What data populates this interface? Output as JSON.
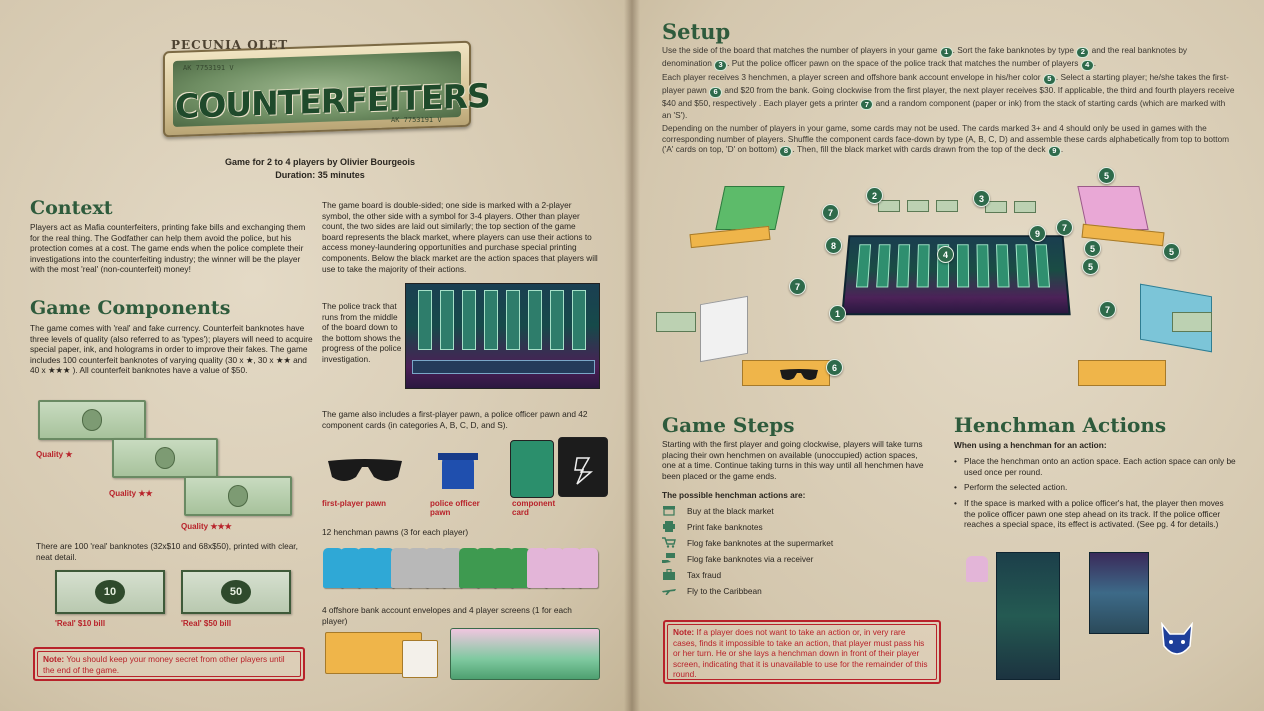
{
  "logo": {
    "brand": "PECUNIA OLET",
    "title": "COUNTERFEITERS",
    "serial_top": "AK 7753191 V",
    "serial_bottom": "AK 7753191 V"
  },
  "credits": {
    "line1": "Game for 2 to 4 players by Olivier Bourgeois",
    "line2": "Duration: 35 minutes"
  },
  "context": {
    "title": "Context",
    "text": "Players act as Mafia counterfeiters, printing fake bills and exchanging them for the real thing. The Godfather can help them avoid the police, but his protection comes at a cost. The game ends when the police complete their investigations into the counterfeiting industry; the winner will be the player with the most 'real' (non-counterfeit) money!"
  },
  "components": {
    "title": "Game Components",
    "text1": "The game comes with 'real' and fake currency. Counterfeit banknotes have three levels of quality (also referred to as 'types'); players will need to acquire special paper, ink, and holograms in order to improve their fakes. The game includes 100 counterfeit banknotes of varying quality (30 x ★, 30 x ★★ and 40 x ★★★ ). All counterfeit banknotes have a value of $50.",
    "quality1": "Quality ★",
    "quality2": "Quality ★★",
    "quality3": "Quality ★★★",
    "real_text": "There are 100 'real' banknotes (32x$10 and 68x$50), printed with clear, neat detail.",
    "real10_value": "10",
    "real50_value": "50",
    "real10_label": "'Real' $10 bill",
    "real50_label": "'Real' $50 bill",
    "note_label": "Note:",
    "note_text": "You should keep your money secret from other players until the end of the game."
  },
  "board": {
    "text": "The game board is double-sided; one side is marked with a 2-player symbol, the other side with a symbol for 3-4 players. Other than player count, the two sides are laid out similarly; the top section of the game board represents the black market, where players can use their actions to access money-laundering opportunities and purchase special printing components. Below the black market are the action spaces that players will use to take the majority of their actions.",
    "police_text": "The police track that runs from the middle of the board down to the bottom shows the progress of the police investigation.",
    "also_text": "The game also includes a first-player pawn, a police officer pawn and 42 component cards (in categories A, B, C, D, and S).",
    "first_player": "first-player pawn",
    "police_pawn": "police officer pawn",
    "component_card": "component card",
    "henchman_text": "12 henchman pawns (3 for each player)",
    "envelope_text": "4 offshore bank account envelopes and 4 player screens (1 for each player)"
  },
  "setup": {
    "title": "Setup",
    "p1": {
      "a": "Use the side of the board that matches the number of players in your game",
      "b": ". Sort the fake banknotes by type",
      "c": "and the real banknotes by denomination",
      "d": ". Put the police officer pawn on the space of the police track that matches the number of players",
      "e": "."
    },
    "p2": {
      "a": "Each player receives 3 henchmen, a player screen and offshore bank account envelope in his/her color",
      "b": ". Select a starting player; he/she takes the first-player pawn",
      "c": "and $20 from the bank. Going clockwise from the first player, the next player receives $30. If applicable, the third and fourth players receive $40 and $50, respectively . Each player gets a printer",
      "d": "and a random component (paper or ink) from the stack of starting cards (which are marked with an 'S')."
    },
    "p3": {
      "a": "Depending on the number of players in your game, some cards may not be used. The cards marked 3+ and 4 should only be used in games with the corresponding number of players. Shuffle the component cards face-down by type (A, B, C, D) and assemble these cards alphabetically from top to bottom ('A' cards on top, 'D' on bottom)",
      "b": ". Then, fill the black market with cards drawn from the top of the deck",
      "c": "."
    },
    "markers": [
      "1",
      "2",
      "3",
      "4",
      "5",
      "6",
      "7",
      "8",
      "9"
    ]
  },
  "steps": {
    "title": "Game Steps",
    "text": "Starting with the first player and going clockwise, players will take turns placing their own henchmen on available (unoccupied) action spaces, one at a time. Continue taking turns in this way until all henchmen have been placed or the game ends.",
    "subtitle": "The possible henchman actions are:",
    "actions": [
      "Buy at the black market",
      "Print fake banknotes",
      "Flog fake banknotes at the supermarket",
      "Flog fake banknotes via a receiver",
      "Tax fraud",
      "Fly to the Caribbean"
    ],
    "note_label": "Note:",
    "note_text": "If a player does not want to take an action or, in very rare cases, finds it impossible to take an action, that player must pass his or her turn. He or she lays a henchman down in front of their player screen, indicating that it is unavailable to use for the remainder of this round."
  },
  "henchman": {
    "title": "Henchman Actions",
    "subtitle": "When using a henchman for an action:",
    "bullets": [
      "Place the henchman onto an action space. Each action space can only be used once per round.",
      "Perform the selected action.",
      "If the space is marked with a police officer's hat, the player then moves the police officer pawn one step ahead on its track. If the police officer reaches a special space, its effect is activated. (See pg. 4 for details.)"
    ]
  },
  "colors": {
    "heading_green": "#2e5b3c",
    "note_red": "#b8222a",
    "marker_green": "#2e6a4b"
  }
}
